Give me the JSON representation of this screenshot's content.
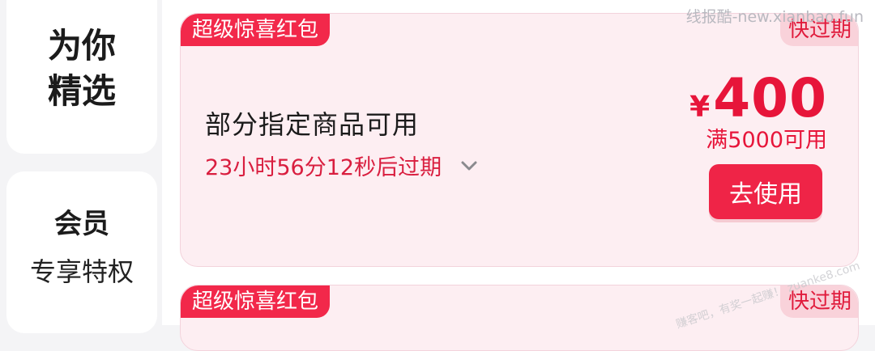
{
  "sidebar": {
    "top_line1": "为你",
    "top_line2": "精选",
    "member_title": "会员",
    "member_sub": "专享特权"
  },
  "coupons": [
    {
      "tag": "超级惊喜红包",
      "badge": "快过期",
      "title": "部分指定商品可用",
      "expiry": "23小时56分12秒后过期",
      "currency": "¥",
      "amount": "400",
      "condition": "满5000可用",
      "button": "去使用"
    },
    {
      "tag": "超级惊喜红包",
      "badge": "快过期"
    }
  ],
  "watermark": "线报酷-new.xianbao.fun",
  "watermark2": "赚客吧，有奖一起赚！ zuanke8.com",
  "colors": {
    "accent": "#e7153a",
    "tag_bg": "#f2284a",
    "coupon_bg": "#fdeef2"
  }
}
